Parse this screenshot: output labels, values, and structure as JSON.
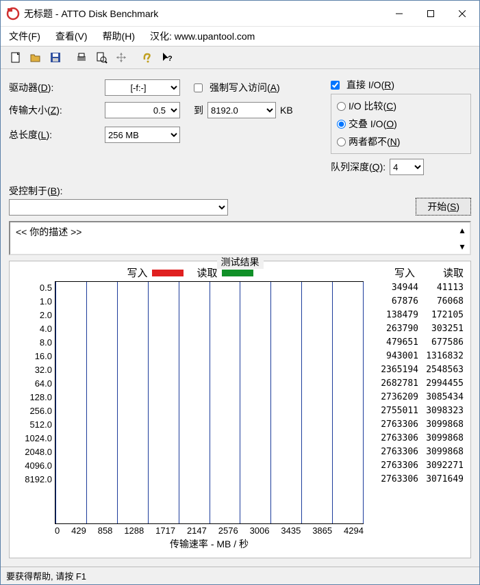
{
  "window_title": "无标题 - ATTO Disk Benchmark",
  "menu": {
    "file": "文件(F)",
    "view": "查看(V)",
    "help": "帮助(H)",
    "credit": "汉化: www.upantool.com"
  },
  "labels": {
    "drive": "驱动器",
    "drive_key": "D",
    "transfer": "传输大小",
    "transfer_key": "Z",
    "to": "到",
    "kb": "KB",
    "length": "总长度",
    "length_key": "L",
    "force_write": "强制写入访问",
    "force_write_key": "A",
    "direct_io": "直接 I/O",
    "direct_io_key": "R",
    "io_compare": "I/O 比较",
    "io_compare_key": "C",
    "overlapped": "交叠 I/O",
    "overlapped_key": "O",
    "neither": "两者都不",
    "neither_key": "N",
    "queue": "队列深度",
    "queue_key": "Q",
    "controlled": "受控制于",
    "controlled_key": "B",
    "start": "开始",
    "start_key": "S",
    "desc": "<<  你的描述   >>",
    "results": "测试结果",
    "write": "写入",
    "read": "读取",
    "xlabel": "传输速率 - MB / 秒"
  },
  "values": {
    "drive": "[-f:-]",
    "from": "0.5",
    "to": "8192.0",
    "length": "256 MB",
    "queue": "4",
    "force_write": false,
    "direct_io": true,
    "radio": "overlapped"
  },
  "colors": {
    "write": "#e02020",
    "read": "#109028"
  },
  "status": "要获得帮助, 请按 F1",
  "chart_data": {
    "type": "bar",
    "orientation": "horizontal",
    "categories": [
      "0.5",
      "1.0",
      "2.0",
      "4.0",
      "8.0",
      "16.0",
      "32.0",
      "64.0",
      "128.0",
      "256.0",
      "512.0",
      "1024.0",
      "2048.0",
      "4096.0",
      "8192.0"
    ],
    "series": [
      {
        "name": "写入",
        "color": "#e02020",
        "values": [
          34944,
          67876,
          138479,
          263790,
          479651,
          943001,
          2365194,
          2682781,
          2736209,
          2755011,
          2763306,
          2763306,
          2763306,
          2763306,
          2763306
        ]
      },
      {
        "name": "读取",
        "color": "#109028",
        "values": [
          41113,
          76068,
          172105,
          303251,
          677586,
          1316832,
          2548563,
          2994455,
          3085434,
          3098323,
          3099868,
          3099868,
          3099868,
          3092271,
          3071649
        ]
      }
    ],
    "xlabel": "传输速率 - MB / 秒",
    "x_ticks": [
      0,
      429,
      858,
      1288,
      1717,
      2147,
      2576,
      3006,
      3435,
      3865,
      4294
    ],
    "xlim": [
      0,
      4294
    ]
  }
}
